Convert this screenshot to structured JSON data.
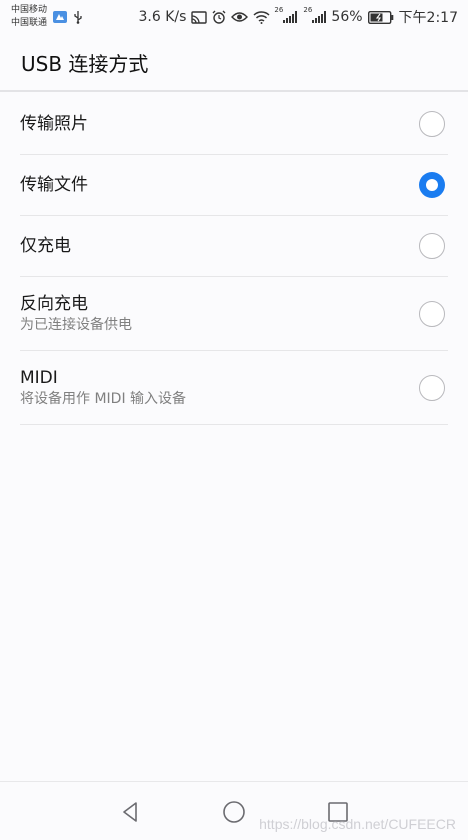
{
  "status_bar": {
    "carrier_1": "中国移动",
    "carrier_2": "中国联通",
    "speed": "3.6 K/s",
    "signal_1_tag": "26",
    "signal_2_tag": "26",
    "battery": "56%",
    "time": "下午2:17",
    "icons": [
      "app-notification-icon",
      "usb-icon",
      "cast-icon",
      "alarm-icon",
      "eye-icon",
      "wifi-icon",
      "signal-icon",
      "signal-icon",
      "battery-icon"
    ]
  },
  "header": {
    "title": "USB 连接方式"
  },
  "options": [
    {
      "label": "传输照片",
      "sub": "",
      "selected": false
    },
    {
      "label": "传输文件",
      "sub": "",
      "selected": true
    },
    {
      "label": "仅充电",
      "sub": "",
      "selected": false
    },
    {
      "label": "反向充电",
      "sub": "为已连接设备供电",
      "selected": false
    },
    {
      "label": "MIDI",
      "sub": "将设备用作 MIDI 输入设备",
      "selected": false
    }
  ],
  "nav": {
    "icons": [
      "back-icon",
      "home-icon",
      "recents-icon"
    ]
  },
  "watermark": "https://blog.csdn.net/CUFEECR",
  "colors": {
    "accent": "#1a7cf0",
    "background": "#fbfbfd"
  }
}
